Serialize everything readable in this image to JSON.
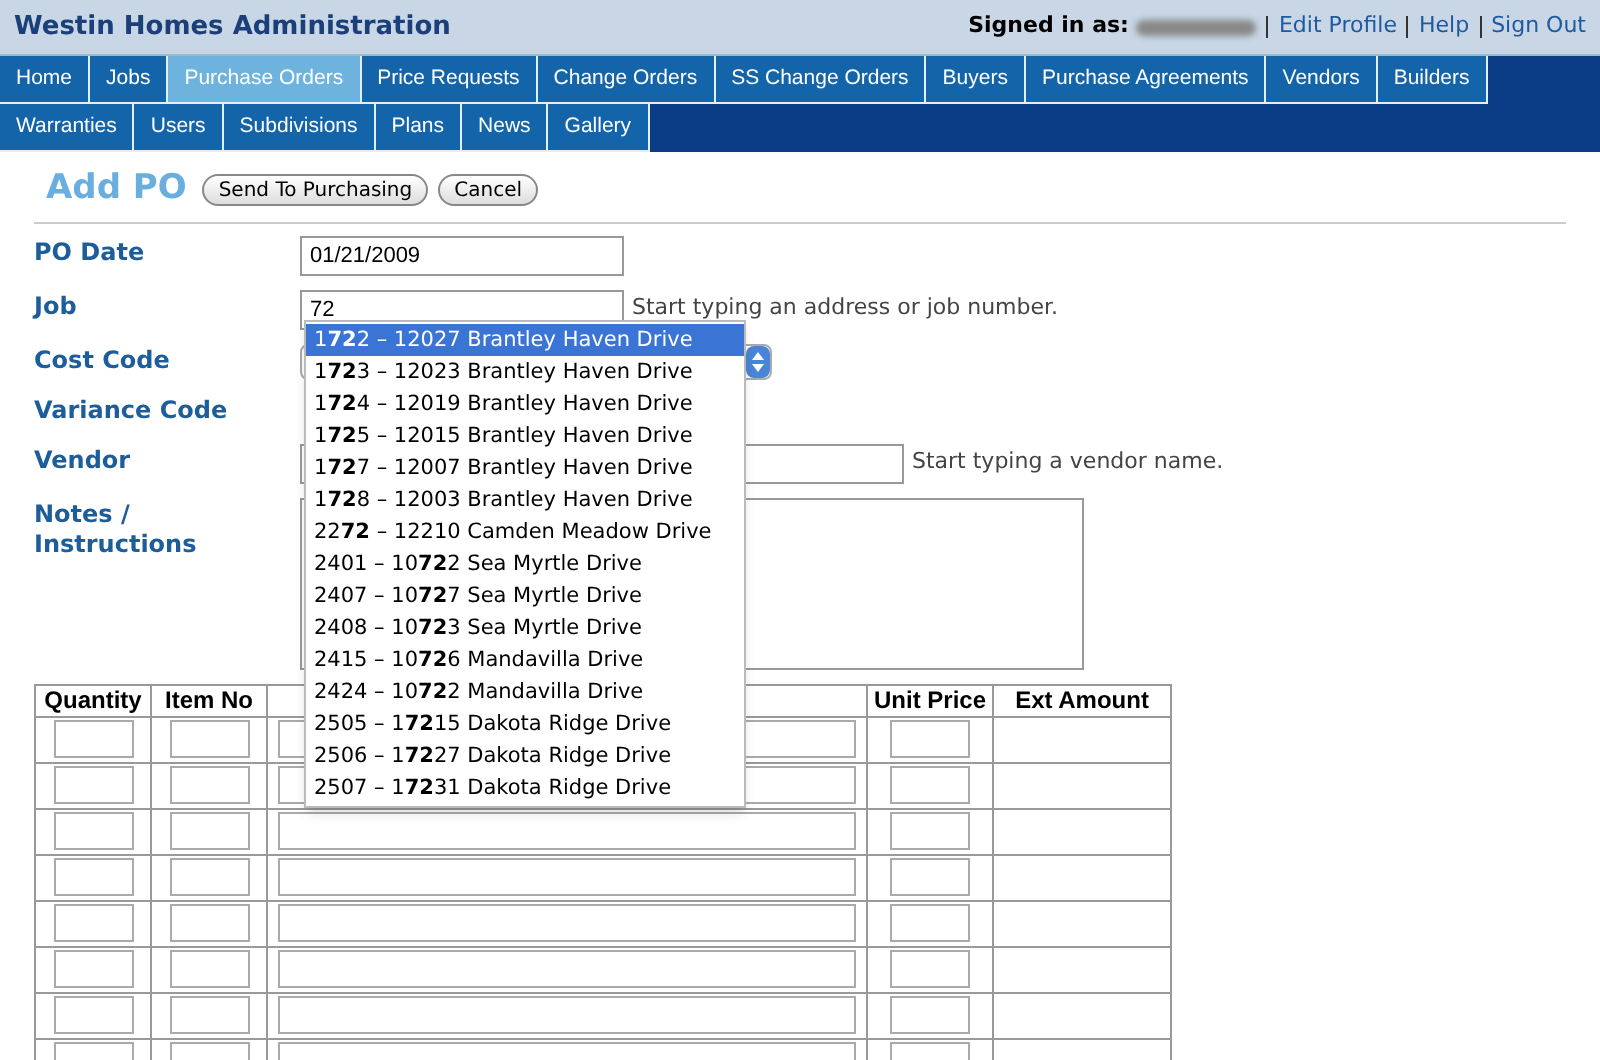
{
  "header": {
    "title": "Westin Homes Administration",
    "signed_in_label": "Signed in as:",
    "links": [
      "Edit Profile",
      "Help",
      "Sign Out"
    ]
  },
  "nav": {
    "rows": [
      {
        "tabs": [
          {
            "label": "Home",
            "selected": false
          },
          {
            "label": "Jobs",
            "selected": false
          },
          {
            "label": "Purchase Orders",
            "selected": true
          },
          {
            "label": "Price Requests",
            "selected": false
          },
          {
            "label": "Change Orders",
            "selected": false
          },
          {
            "label": "SS Change Orders",
            "selected": false
          },
          {
            "label": "Buyers",
            "selected": false
          },
          {
            "label": "Purchase Agreements",
            "selected": false
          },
          {
            "label": "Vendors",
            "selected": false
          },
          {
            "label": "Builders",
            "selected": false
          }
        ]
      },
      {
        "tabs": [
          {
            "label": "Warranties",
            "selected": false
          },
          {
            "label": "Users",
            "selected": false
          },
          {
            "label": "Subdivisions",
            "selected": false
          },
          {
            "label": "Plans",
            "selected": false
          },
          {
            "label": "News",
            "selected": false
          },
          {
            "label": "Gallery",
            "selected": false
          }
        ]
      }
    ]
  },
  "page": {
    "title": "Add PO",
    "buttons": [
      "Send To Purchasing",
      "Cancel"
    ]
  },
  "form": {
    "fields": [
      {
        "label": "PO Date",
        "kind": "text",
        "value": "01/21/2009"
      },
      {
        "label": "Job",
        "kind": "text",
        "value": "72",
        "hint": "Start typing an address or job number."
      },
      {
        "label": "Cost Code",
        "kind": "select"
      },
      {
        "label": "Variance Code",
        "kind": "hidden"
      },
      {
        "label": "Vendor",
        "kind": "text",
        "hint": "Start typing a vendor name."
      },
      {
        "label": "Notes / Instructions",
        "kind": "textarea"
      }
    ]
  },
  "suggestions": [
    {
      "text": "1**72**2 – 12027 Brantley Haven Drive",
      "selected": true
    },
    {
      "text": "1**72**3 – 12023 Brantley Haven Drive",
      "selected": false
    },
    {
      "text": "1**72**4 – 12019 Brantley Haven Drive",
      "selected": false
    },
    {
      "text": "1**72**5 – 12015 Brantley Haven Drive",
      "selected": false
    },
    {
      "text": "1**72**7 – 12007 Brantley Haven Drive",
      "selected": false
    },
    {
      "text": "1**72**8 – 12003 Brantley Haven Drive",
      "selected": false
    },
    {
      "text": "22**72** – 12210 Camden Meadow Drive",
      "selected": false
    },
    {
      "text": "2401 – 10**72**2 Sea Myrtle Drive",
      "selected": false
    },
    {
      "text": "2407 – 10**72**7 Sea Myrtle Drive",
      "selected": false
    },
    {
      "text": "2408 – 10**72**3 Sea Myrtle Drive",
      "selected": false
    },
    {
      "text": "2415 – 10**72**6 Mandavilla Drive",
      "selected": false
    },
    {
      "text": "2424 – 10**72**2 Mandavilla Drive",
      "selected": false
    },
    {
      "text": "2505 – 1**72**15 Dakota Ridge Drive",
      "selected": false
    },
    {
      "text": "2506 – 1**72**27 Dakota Ridge Drive",
      "selected": false
    },
    {
      "text": "2507 – 1**72**31 Dakota Ridge Drive",
      "selected": false
    }
  ],
  "table": {
    "columns": [
      {
        "label": "Quantity",
        "kind": "small"
      },
      {
        "label": "Item No",
        "kind": "small"
      },
      {
        "kind": "wide"
      },
      {
        "label": "Unit Price",
        "kind": "small"
      },
      {
        "label": "Ext Amount",
        "kind": "amount"
      }
    ],
    "rows": [
      {
        "kind": "entry"
      },
      {
        "kind": "entry"
      },
      {
        "kind": "entry"
      },
      {
        "kind": "entry"
      },
      {
        "kind": "entry"
      },
      {
        "kind": "entry"
      },
      {
        "kind": "entry"
      },
      {
        "kind": "entry"
      }
    ]
  }
}
